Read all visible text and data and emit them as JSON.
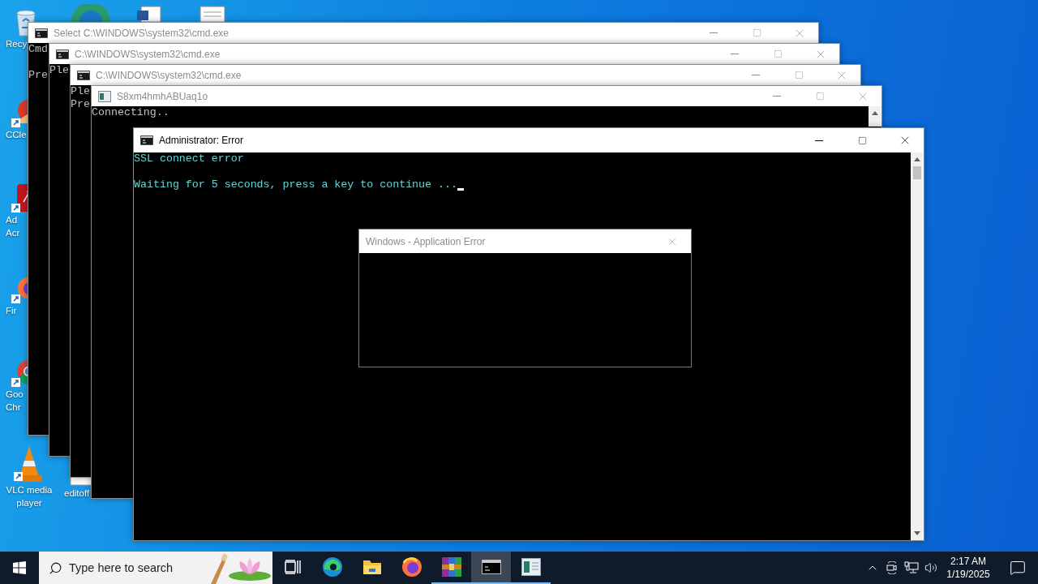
{
  "desktop_icons": [
    {
      "kind": "recycle-bin",
      "label": [
        "Recy"
      ]
    },
    {
      "kind": "ccleaner",
      "label": [
        "CCle"
      ]
    },
    {
      "kind": "acrobat",
      "label": [
        "Ad",
        "Acr"
      ]
    },
    {
      "kind": "firefox",
      "label": [
        "Fir"
      ]
    },
    {
      "kind": "chrome",
      "label": [
        "Goo",
        "Chr"
      ]
    },
    {
      "kind": "vlc",
      "label": [
        "VLC media",
        "player"
      ]
    },
    {
      "kind": "document",
      "label": [
        "editoff"
      ]
    }
  ],
  "windows": [
    {
      "title": "Select C:\\WINDOWS\\system32\\cmd.exe",
      "kind": "console",
      "active": false,
      "paragraphs": [
        [
          "Cmd"
        ],
        [
          "Pre"
        ]
      ]
    },
    {
      "title": "C:\\WINDOWS\\system32\\cmd.exe",
      "kind": "console",
      "active": false,
      "paragraphs": [
        [
          "Ple"
        ]
      ]
    },
    {
      "title": "C:\\WINDOWS\\system32\\cmd.exe",
      "kind": "console",
      "active": false,
      "paragraphs": [
        [
          "Ple",
          "Pre"
        ]
      ]
    },
    {
      "title": "S8xm4hmhABUaq1o",
      "kind": "app",
      "active": false,
      "paragraphs": [
        [
          "Connecting.."
        ]
      ]
    },
    {
      "title": "Administrator:  Error",
      "kind": "console",
      "active": true,
      "color": "#61d6d6",
      "cursor": true,
      "paragraphs": [
        [
          "SSL connect error"
        ],
        [
          "Waiting for 5 seconds, press a key to continue ..."
        ]
      ]
    }
  ],
  "dialog": {
    "title": "Windows - Application Error"
  },
  "taskbar": {
    "search": {
      "placeholder": "Type here to search"
    },
    "apps": [
      {
        "kind": "task-view",
        "selected": false,
        "running": false
      },
      {
        "kind": "edge",
        "selected": false,
        "running": false
      },
      {
        "kind": "explorer",
        "selected": false,
        "running": false
      },
      {
        "kind": "firefox",
        "selected": false,
        "running": false
      },
      {
        "kind": "winrar",
        "selected": false,
        "running": true
      },
      {
        "kind": "console",
        "selected": true,
        "running": true
      },
      {
        "kind": "app",
        "selected": false,
        "running": true
      }
    ],
    "clock": {
      "time": "2:17 AM",
      "date": "1/19/2025"
    }
  }
}
